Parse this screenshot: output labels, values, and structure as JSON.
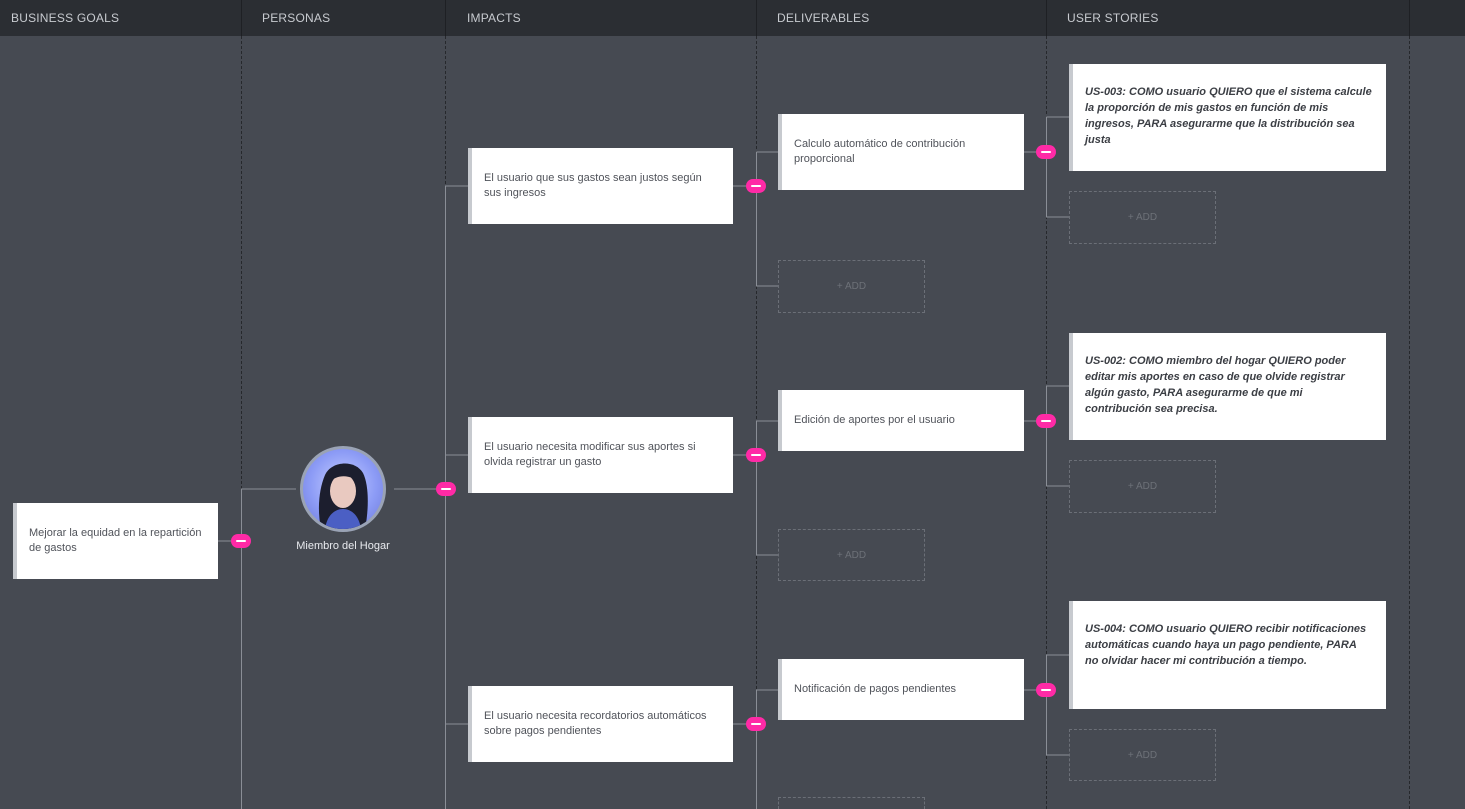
{
  "columns": {
    "business_goals": "BUSINESS GOALS",
    "personas": "PERSONAS",
    "impacts": "IMPACTS",
    "deliverables": "DELIVERABLES",
    "user_stories": "USER STORIES"
  },
  "goal": {
    "text": "Mejorar la equidad en la repartición de gastos"
  },
  "persona": {
    "name": "Miembro del Hogar"
  },
  "impacts": [
    {
      "text": "El usuario que sus gastos sean justos según sus ingresos"
    },
    {
      "text": "El usuario necesita modificar sus aportes si olvida registrar un gasto"
    },
    {
      "text": "El usuario necesita recordatorios automáticos sobre pagos pendientes"
    }
  ],
  "deliverables": [
    {
      "text": "Calculo automático de contribución proporcional"
    },
    {
      "text": "Edición de aportes por el usuario"
    },
    {
      "text": "Notificación de pagos pendientes"
    }
  ],
  "stories": [
    {
      "text": "US-003: COMO usuario QUIERO que el sistema calcule la proporción de mis gastos en función de mis ingresos, PARA asegurarme que la distribución sea justa"
    },
    {
      "text": "US-002: COMO miembro del hogar QUIERO poder editar mis aportes en caso de que olvide registrar algún gasto, PARA asegurarme de que mi contribución sea precisa."
    },
    {
      "text": "US-004: COMO usuario QUIERO recibir notificaciones automáticas cuando haya un pago pendiente, PARA no olvidar hacer mi contribución a tiempo."
    }
  ],
  "add_label": "+ ADD",
  "colors": {
    "background": "#464a52",
    "header": "#2b2e33",
    "accent": "#ff2aa6",
    "card": "#ffffff"
  },
  "icons": {
    "collapse": "minus-icon",
    "avatar": "user-avatar-photo"
  }
}
